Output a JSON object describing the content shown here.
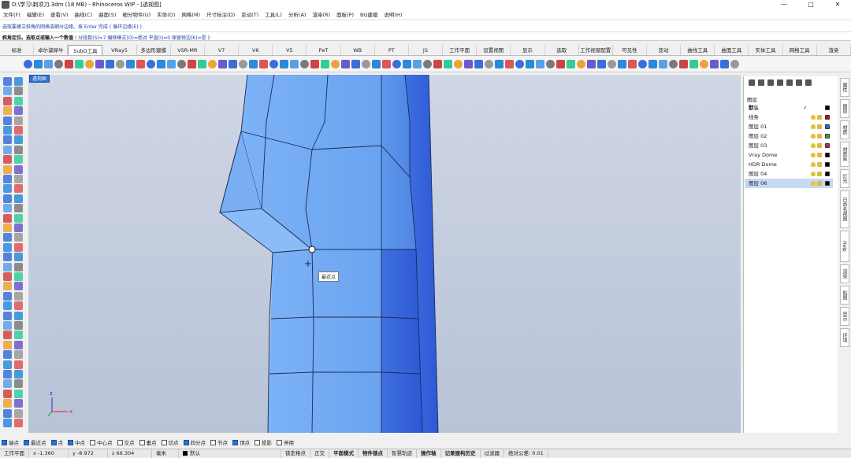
{
  "window": {
    "title": "D:\\学习\\剃须刀.3dm (18 MB) - Rhinoceros WIP - [透视图]",
    "min": "—",
    "max": "□",
    "close": "✕"
  },
  "menu": [
    "文件(F)",
    "编辑(E)",
    "查看(V)",
    "曲线(C)",
    "曲面(S)",
    "细分物件(U)",
    "实体(O)",
    "网格(M)",
    "尺寸标注(D)",
    "变动(T)",
    "工具(L)",
    "分析(A)",
    "渲染(R)",
    "面板(P)",
    "BG建模",
    "说明(H)"
  ],
  "command": {
    "history": "选取要建立斜角的网格或细分边缘。按 Enter 完成 ( 循环边缘(E) )",
    "prompt": "斜角定位。选取点或输入一个数值",
    "options": "( 分段数(S)=7  偏移模式(O)=绝对  平直(I)=0  保留锐边(K)=是 ):"
  },
  "tabs": [
    "标准",
    "卓尔谟犀牛",
    "SubD工具",
    "VRay5",
    "多边形建模",
    "VSR-MR",
    "V7",
    "V6",
    "V5",
    "PeT",
    "WB",
    "PT",
    "JS",
    "工作平面",
    "设置视图",
    "显示",
    "选取",
    "工作视窗配置",
    "可见性",
    "变动",
    "曲线工具",
    "曲面工具",
    "实体工具",
    "网格工具",
    "渲染"
  ],
  "active_tab_index": 2,
  "viewport": {
    "label": "透视图",
    "tooltip": "最近点",
    "axis_x": "x",
    "axis_z": "z"
  },
  "layers": {
    "header": "图层",
    "rows": [
      {
        "name": "默认",
        "color": "#000000",
        "current": "✓"
      },
      {
        "name": "线条",
        "color": "#e00000"
      },
      {
        "name": "图层 01",
        "color": "#1e6fd9"
      },
      {
        "name": "图层 02",
        "color": "#1fb13a"
      },
      {
        "name": "图层 03",
        "color": "#d41670"
      },
      {
        "name": "Vray Dome",
        "color": "#000000"
      },
      {
        "name": "HDR Dome",
        "color": "#000000"
      },
      {
        "name": "图层 04",
        "color": "#000000"
      },
      {
        "name": "图层 06",
        "color": "#000000"
      }
    ],
    "active_index": 8
  },
  "side_tabs": [
    "属性",
    "图层",
    "材质",
    "材质库",
    "灯光",
    "已命名视图",
    "Help",
    "渲染",
    "贴图",
    "显示",
    "环境"
  ],
  "snaps": [
    {
      "label": "端点",
      "on": true
    },
    {
      "label": "最近点",
      "on": true
    },
    {
      "label": "点",
      "on": true
    },
    {
      "label": "中点",
      "on": true
    },
    {
      "label": "中心点",
      "on": false
    },
    {
      "label": "交点",
      "on": false
    },
    {
      "label": "垂点",
      "on": false
    },
    {
      "label": "切点",
      "on": false
    },
    {
      "label": "四分点",
      "on": true
    },
    {
      "label": "节点",
      "on": false
    },
    {
      "label": "顶点",
      "on": true
    },
    {
      "label": "投影",
      "on": false
    },
    {
      "label": "停用",
      "on": false
    }
  ],
  "status": {
    "cplane": "工作平面",
    "x": "x -1.360",
    "y": "y -8.972",
    "z": "z 66.304",
    "unit": "毫米",
    "layer": "默认",
    "items": [
      "锁定格点",
      "正交",
      "平面模式",
      "物件锁点",
      "智慧轨迹",
      "操作轴",
      "记录建构历史",
      "过滤器"
    ],
    "bold_items": [
      2,
      3,
      5,
      6
    ],
    "tolerance": "绝对公差: 0.01"
  },
  "colors": {
    "face_light": "#6fa6f2",
    "face_mid": "#5b93ea",
    "face_dark": "#2d58d6",
    "edge": "#1a2a55",
    "accent": "#2d6fd1"
  }
}
